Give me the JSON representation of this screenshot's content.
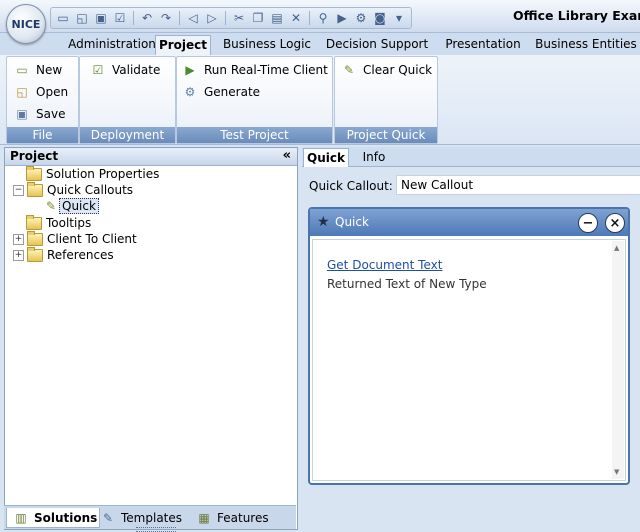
{
  "app": {
    "logo_text": "NICE",
    "title": "Office Library Exam"
  },
  "quick_access": {
    "icons": [
      "new-icon",
      "open-icon",
      "save-icon",
      "validate-icon",
      "undo-icon",
      "redo-icon",
      "back-icon",
      "forward-icon",
      "cut-icon",
      "copy-icon",
      "paste-icon",
      "delete-icon",
      "find-icon",
      "run-icon",
      "generate-icon",
      "camera-icon",
      "customize-icon"
    ]
  },
  "ribbon_tabs": [
    "Administration",
    "Project",
    "Business Logic",
    "Decision Support",
    "Presentation",
    "Business Entities"
  ],
  "ribbon_active_tab": "Project",
  "ribbon_groups": {
    "file": {
      "label": "File",
      "new": "New",
      "open": "Open",
      "save": "Save"
    },
    "deployment": {
      "label": "Deployment",
      "validate": "Validate"
    },
    "test_project": {
      "label": "Test Project",
      "run": "Run Real-Time Client",
      "generate": "Generate"
    },
    "project_quick": {
      "label": "Project Quick",
      "clear": "Clear Quick"
    }
  },
  "left_panel": {
    "title": "Project",
    "collapse_glyph": "«",
    "tree": {
      "solution_properties": "Solution Properties",
      "quick_callouts": "Quick Callouts",
      "quick": "Quick",
      "tooltips": "Tooltips",
      "client_to_client": "Client To Client",
      "references": "References"
    },
    "bottom_tabs": {
      "solutions": "Solutions",
      "templates": "Templates",
      "features": "Features"
    }
  },
  "content": {
    "tabs": [
      "Quick",
      "Info"
    ],
    "active_tab": "Quick",
    "callout_label": "Quick Callout:",
    "callout_value": "New Callout",
    "callout_window": {
      "title": "Quick",
      "link_text": "Get Document Text",
      "body_text": "Returned Text of New Type"
    }
  },
  "colors": {
    "accent": "#4d79b6",
    "group_footer": "#7a9ac6",
    "link": "#1f4fa0"
  }
}
